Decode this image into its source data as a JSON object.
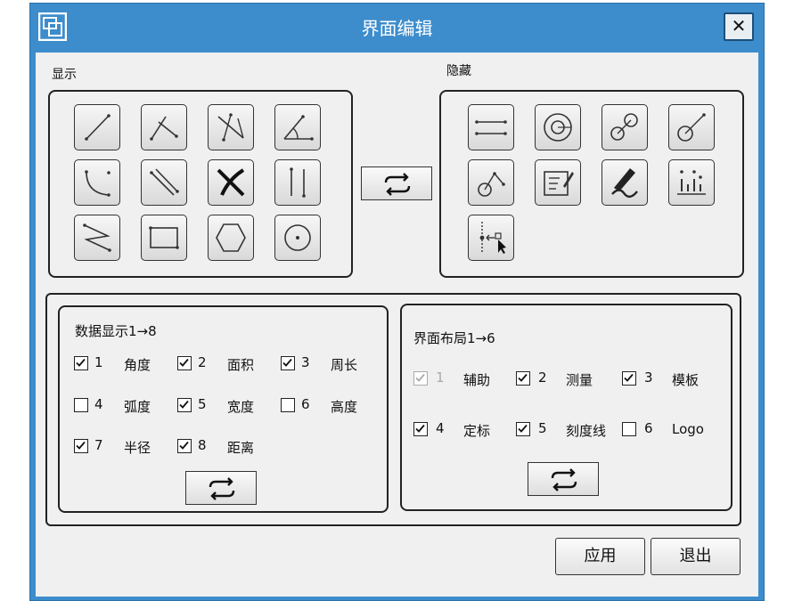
{
  "window": {
    "title": "界面编辑",
    "close_label": "✕"
  },
  "show": {
    "label": "显示",
    "tools": [
      "line-tool-icon",
      "two-line-angle-icon",
      "crossed-distance-icon",
      "angle-arc-icon",
      "arc-three-point-icon",
      "parallel-line-icon",
      "curve-cross-icon",
      "vertical-parallel-icon",
      "zigzag-line-icon",
      "rectangle-icon",
      "hexagon-icon",
      "circle-center-icon"
    ]
  },
  "hide": {
    "label": "隐藏",
    "tools": [
      "double-line-icon",
      "concentric-circle-icon",
      "two-circle-link-icon",
      "circle-line-icon",
      "circle-branch-icon",
      "text-annotation-icon",
      "pencil-draw-icon",
      "bar-chart-icon",
      "point-cursor-icon"
    ]
  },
  "data_display": {
    "title": "数据显示1→8",
    "items": [
      {
        "num": "1",
        "label": "角度",
        "checked": true
      },
      {
        "num": "2",
        "label": "面积",
        "checked": true
      },
      {
        "num": "3",
        "label": "周长",
        "checked": true
      },
      {
        "num": "4",
        "label": "弧度",
        "checked": false
      },
      {
        "num": "5",
        "label": "宽度",
        "checked": true
      },
      {
        "num": "6",
        "label": "高度",
        "checked": false
      },
      {
        "num": "7",
        "label": "半径",
        "checked": true
      },
      {
        "num": "8",
        "label": "距离",
        "checked": true
      }
    ]
  },
  "layout": {
    "title": "界面布局1→6",
    "items": [
      {
        "num": "1",
        "label": "辅助",
        "checked": true,
        "disabled": true
      },
      {
        "num": "2",
        "label": "测量",
        "checked": true,
        "disabled": false
      },
      {
        "num": "3",
        "label": "模板",
        "checked": true,
        "disabled": false
      },
      {
        "num": "4",
        "label": "定标",
        "checked": true,
        "disabled": false
      },
      {
        "num": "5",
        "label": "刻度线",
        "checked": true,
        "disabled": false
      },
      {
        "num": "6",
        "label": "Logo",
        "checked": false,
        "disabled": false
      }
    ]
  },
  "buttons": {
    "apply": "应用",
    "exit": "退出"
  }
}
